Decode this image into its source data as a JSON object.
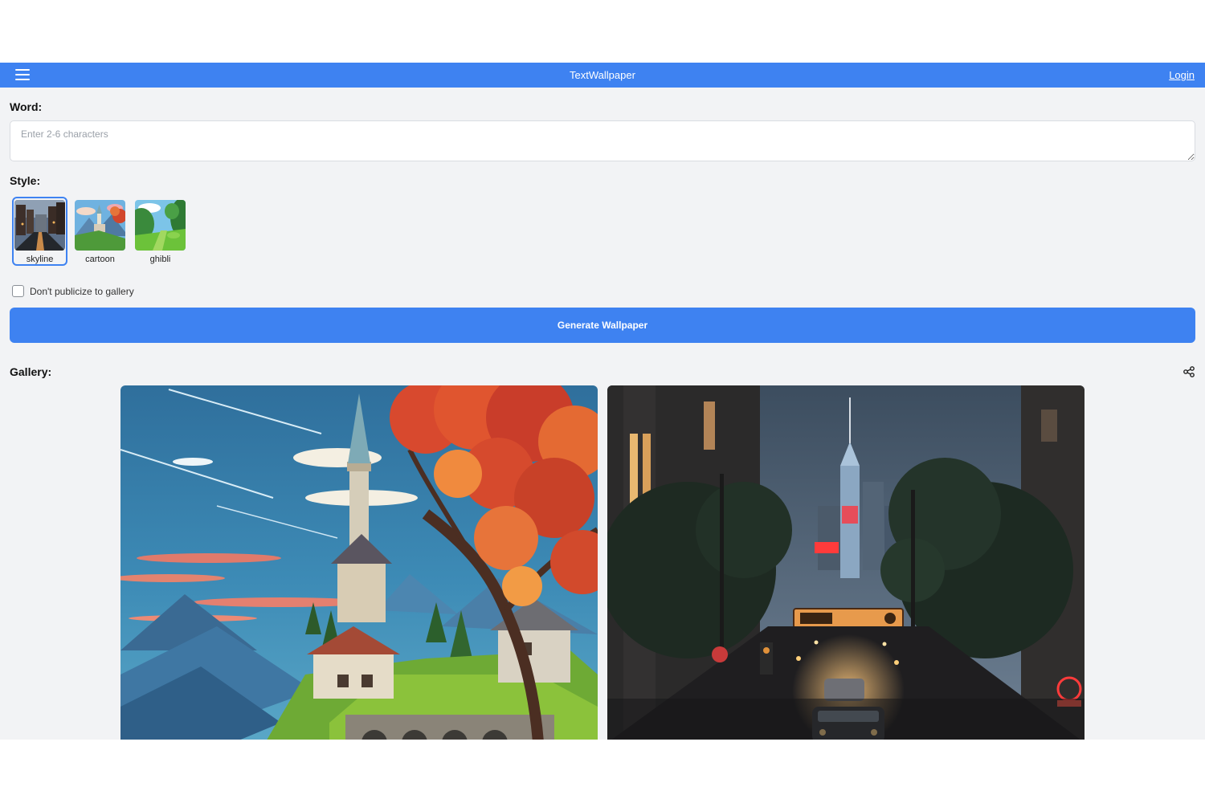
{
  "header": {
    "title": "TextWallpaper",
    "login_label": "Login",
    "color": "#3e82f1"
  },
  "form": {
    "word_label": "Word:",
    "word_placeholder": "Enter 2-6 characters",
    "word_value": "",
    "style_label": "Style:",
    "styles": [
      {
        "name": "skyline",
        "selected": true
      },
      {
        "name": "cartoon",
        "selected": false
      },
      {
        "name": "ghibli",
        "selected": false
      }
    ],
    "private_label": "Don't publicize to gallery",
    "private_checked": false,
    "generate_label": "Generate Wallpaper"
  },
  "gallery": {
    "label": "Gallery:",
    "items": [
      {
        "scene": "cartoon castle on hillside with autumn tree and mountains"
      },
      {
        "scene": "city street at night with skyscraper and neon signs"
      }
    ]
  },
  "icons": [
    "menu-icon",
    "share-icon"
  ]
}
